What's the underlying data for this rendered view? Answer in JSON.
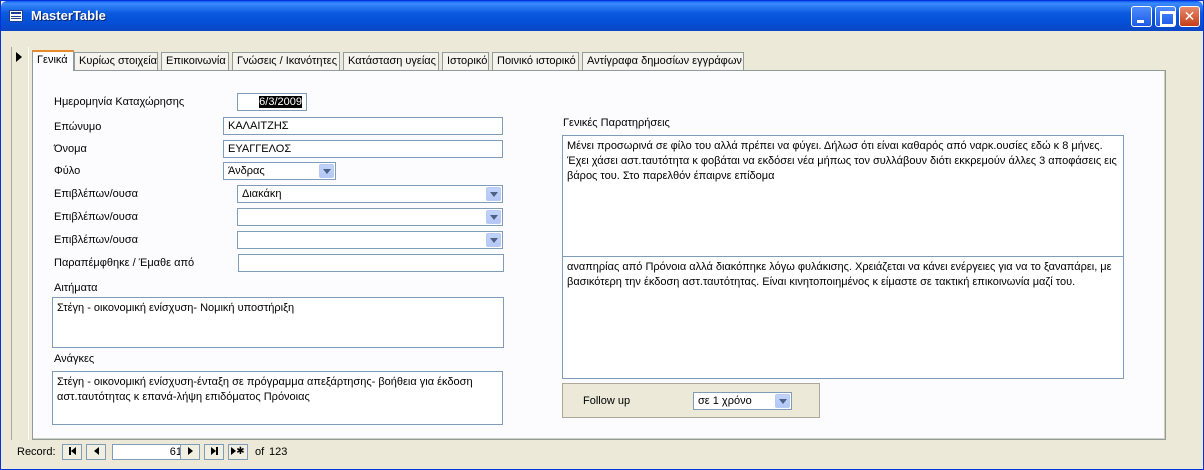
{
  "window": {
    "title": "MasterTable"
  },
  "tabs": [
    {
      "label": "Γενικά",
      "active": true
    },
    {
      "label": "Κυρίως στοιχεία",
      "active": false
    },
    {
      "label": "Επικοινωνία",
      "active": false
    },
    {
      "label": "Γνώσεις / Ικανότητες",
      "active": false
    },
    {
      "label": "Κατάσταση υγείας",
      "active": false
    },
    {
      "label": "Ιστορικό",
      "active": false
    },
    {
      "label": "Ποινικό ιστορικό",
      "active": false
    },
    {
      "label": "Αντίγραφα δημοσίων εγγράφων",
      "active": false
    }
  ],
  "form": {
    "registration_date_label": "Ημερομηνία Καταχώρησης",
    "registration_date_value": "6/3/2009",
    "surname_label": "Επώνυμο",
    "surname_value": "ΚΑΛΑΙΤΖΗΣ",
    "name_label": "Όνομα",
    "name_value": "ΕΥΑΓΓΕΛΟΣ",
    "gender_label": "Φύλο",
    "gender_value": "Άνδρας",
    "supervisor1_label": "Επιβλέπων/ουσα",
    "supervisor1_value": "Διακάκη",
    "supervisor2_label": "Επιβλέπων/ουσα",
    "supervisor2_value": "",
    "supervisor3_label": "Επιβλέπων/ουσα",
    "supervisor3_value": "",
    "referred_label": "Παραπέμφθηκε / Έμαθε από",
    "referred_value": "",
    "requests_label": "Αιτήματα",
    "requests_value": "Στέγη - οικονομική ενίσχυση- Νομική υποστήριξη",
    "needs_label": "Ανάγκες",
    "needs_value": "Στέγη - οικονομική ενίσχυση-ένταξη σε πρόγραμμα απεξάρτησης- βοήθεια για έκδοση αστ.ταυτότητας κ επανά-λήψη επιδόματος Πρόνοιας",
    "general_notes_label": "Γενικές Παρατηρήσεις",
    "general_notes_value": "Μένει προσωρινά σε φίλο του αλλά πρέπει να φύγει. Δήλωσ ότι είναι καθαρός από ναρκ.ουσίες εδώ κ 8 μήνες. Έχει χάσει αστ.ταυτότητα κ φοβάται να εκδόσει νέα μήπως τον συλλάβουν διότι εκκρεμούν άλλες 3 αποφάσεις εις βάρος του. Στο παρελθόν έπαιρνε επίδομα",
    "notes2_value": "αναπηρίας από Πρόνοια αλλά διακόπηκε λόγω φυλάκισης. Χρειάζεται να κάνει ενέργειες για να το ξαναπάρει, με βασικότερη την έκδοση αστ.ταυτότητας. Είναι κινητοποιημένος κ είμαστε σε τακτική επικοινωνία μαζί του.",
    "followup_label": "Follow up",
    "followup_value": "σε 1 χρόνο"
  },
  "navigation": {
    "record_label": "Record:",
    "current_record": "61",
    "of_label": "of",
    "total_records": "123"
  }
}
